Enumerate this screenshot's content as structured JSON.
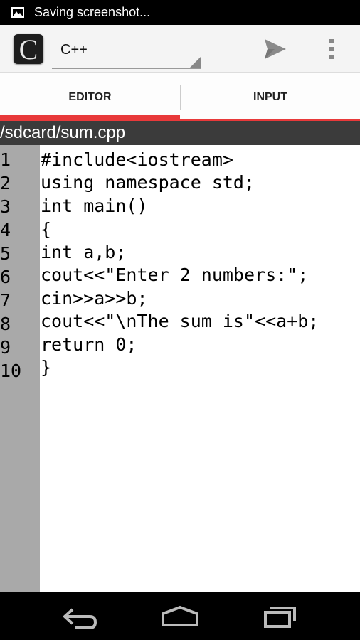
{
  "status_bar": {
    "icon": "picture-icon",
    "notification_text": "Saving screenshot..."
  },
  "action_bar": {
    "app_icon": "compiler-c-logo",
    "app_icon_letter": "C",
    "language_selected": "C++",
    "send_icon": "send-icon",
    "overflow_icon": "overflow-menu-icon"
  },
  "tabs": [
    {
      "label": "EDITOR",
      "selected": true
    },
    {
      "label": "INPUT",
      "selected": false
    }
  ],
  "file_path": "/sdcard/sum.cpp",
  "editor": {
    "line_numbers": [
      "1",
      "2",
      "3",
      "4",
      "5",
      "6",
      "7",
      "8",
      "9",
      "10"
    ],
    "lines": [
      "#include<iostream>",
      "using namespace std;",
      "int main()",
      "{",
      "int a,b;",
      "cout<<\"Enter 2 numbers:\";",
      "cin>>a>>b;",
      "cout<<\"\\nThe sum is\"<<a+b;",
      "return 0;",
      "}"
    ]
  },
  "nav_bar": {
    "back_icon": "back-icon",
    "home_icon": "home-icon",
    "recents_icon": "recents-icon"
  },
  "colors": {
    "accent": "#e8393a",
    "path_bar": "#3b3b3b",
    "gutter": "#a9a9a9"
  }
}
